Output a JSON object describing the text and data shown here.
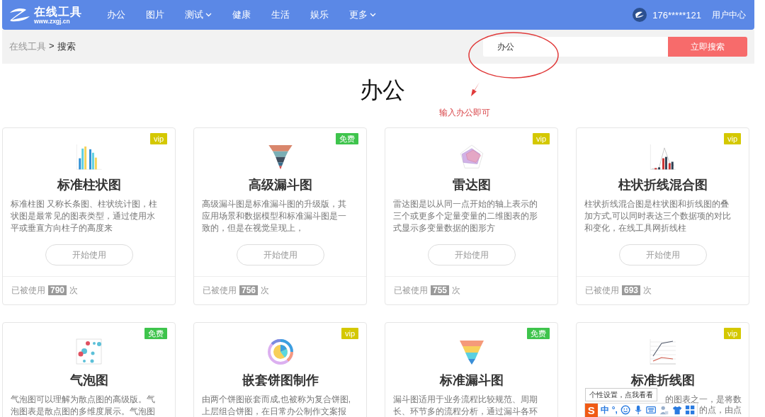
{
  "header": {
    "logo": {
      "name": "在线工具",
      "site": "www.zxgj.cn"
    },
    "nav": [
      {
        "label": "办公",
        "dropdown": false
      },
      {
        "label": "图片",
        "dropdown": false
      },
      {
        "label": "测试",
        "dropdown": true
      },
      {
        "label": "健康",
        "dropdown": false
      },
      {
        "label": "生活",
        "dropdown": false
      },
      {
        "label": "娱乐",
        "dropdown": false
      },
      {
        "label": "更多",
        "dropdown": true
      }
    ],
    "user": {
      "phone": "176*****121",
      "center": "用户中心"
    }
  },
  "breadcrumb": {
    "root": "在线工具",
    "separator": ">",
    "current": "搜索"
  },
  "search": {
    "value": "办公",
    "button": "立即搜索"
  },
  "annotation": "输入办公即可",
  "heading": "办公",
  "cards": [
    {
      "kind": "bar",
      "badge": {
        "kind": "vip",
        "label": "vip"
      },
      "title": "标准柱状图",
      "description_lines": [
        "标准柱图 又称长条图、柱状统计图，柱",
        "状图是最常见的图表类型，通过使用水",
        "平或垂直方向柱子的高度来"
      ],
      "button": "开始使用",
      "usage": {
        "prefix": "已被使用",
        "count": "790",
        "suffix": "次"
      }
    },
    {
      "kind": "funnel3d",
      "badge": {
        "kind": "free",
        "label": "免费"
      },
      "title": "高级漏斗图",
      "description_lines": [
        "高级漏斗图是标准漏斗图的升级版，其",
        "应用场景和数据模型和标准漏斗图是一",
        "致的，但是在视觉呈现上，"
      ],
      "button": "开始使用",
      "usage": {
        "prefix": "已被使用",
        "count": "756",
        "suffix": "次"
      }
    },
    {
      "kind": "radar",
      "badge": {
        "kind": "vip",
        "label": "vip"
      },
      "title": "雷达图",
      "description_lines": [
        "雷达图是以从同一点开始的轴上表示的",
        "三个或更多个定量变量的二维图表的形",
        "式显示多变量数据的图形方"
      ],
      "button": "开始使用",
      "usage": {
        "prefix": "已被使用",
        "count": "755",
        "suffix": "次"
      }
    },
    {
      "kind": "barline",
      "badge": {
        "kind": "vip",
        "label": "vip"
      },
      "title": "柱状折线混合图",
      "description_lines": [
        "柱状折线混合图是柱状图和折线图的叠",
        "加方式,可以同时表达三个数据项的对比",
        "和变化，在线工具网折线柱"
      ],
      "button": "开始使用",
      "usage": {
        "prefix": "已被使用",
        "count": "693",
        "suffix": "次"
      }
    },
    {
      "kind": "bubble",
      "badge": {
        "kind": "free",
        "label": "免费"
      },
      "title": "气泡图",
      "description_lines": [
        "气泡图可以理解为散点图的高级版。气",
        "泡图表是散点图的多维度展示。气泡图"
      ]
    },
    {
      "kind": "nested-pie",
      "badge": {
        "kind": "vip",
        "label": "vip"
      },
      "title": "嵌套饼图制作",
      "description_lines": [
        "由两个饼图嵌套而成,也被称为复合饼图,",
        "上层组合饼图，在日常办公制作文案报"
      ]
    },
    {
      "kind": "funnel",
      "badge": {
        "kind": "free",
        "label": "免费"
      },
      "title": "标准漏斗图",
      "description_lines": [
        "漏斗图适用于业务流程比较规范、周期",
        "长、环节多的流程分析，通过漏斗各环"
      ]
    },
    {
      "kind": "line",
      "badge": {
        "kind": "vip",
        "label": "vip"
      },
      "title": "标准折线图",
      "description_lines": [
        "的图表之一，是将数",
        "的点，由点"
      ]
    }
  ],
  "tooltip": "个性设置，点我看看",
  "ime_toolbar": {
    "logo": "S",
    "mode": "中",
    "punctuation": "°,"
  }
}
